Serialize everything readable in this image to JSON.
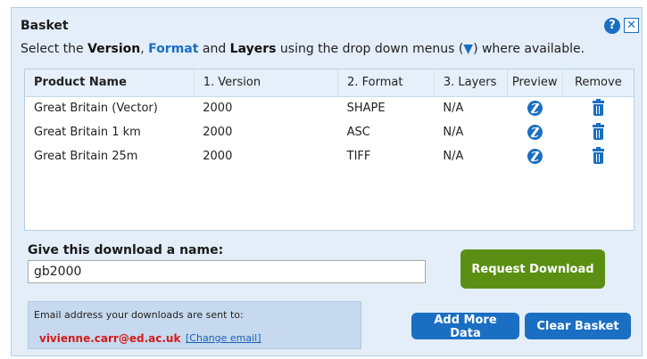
{
  "basket": {
    "title": "Basket",
    "instructions": {
      "prefix": "Select the ",
      "version": "Version",
      "comma": ", ",
      "format": "Format",
      "and": " and ",
      "layers": "Layers",
      "suffix_before_arrow": " using the drop down menus (",
      "arrow": "▼",
      "suffix_after_arrow": ") where available."
    },
    "help_icon": "?",
    "close_icon": "✕"
  },
  "table": {
    "headers": {
      "product_name": "Product Name",
      "version": "1. Version",
      "format": "2. Format",
      "layers": "3. Layers",
      "preview": "Preview",
      "remove": "Remove"
    },
    "rows": [
      {
        "product_name": "Great Britain (Vector)",
        "version": "2000",
        "format": "SHAPE",
        "layers": "N/A"
      },
      {
        "product_name": "Great Britain 1 km",
        "version": "2000",
        "format": "ASC",
        "layers": "N/A"
      },
      {
        "product_name": "Great Britain 25m",
        "version": "2000",
        "format": "TIFF",
        "layers": "N/A"
      }
    ],
    "preview_icon": "globe-icon",
    "remove_icon": "trash-icon"
  },
  "download": {
    "name_label": "Give this download a name:",
    "name_value": "gb2000",
    "request_button": "Request Download",
    "add_more_button": "Add More Data",
    "clear_button": "Clear Basket"
  },
  "email": {
    "caption": "Email address your downloads are sent to:",
    "address": "vivienne.carr@ed.ac.uk",
    "change_link": "[Change email]"
  },
  "colors": {
    "panel_bg": "#e3eef9",
    "accent_blue": "#1a6fc2",
    "request_green": "#5b8f13",
    "email_red": "#d51919"
  }
}
